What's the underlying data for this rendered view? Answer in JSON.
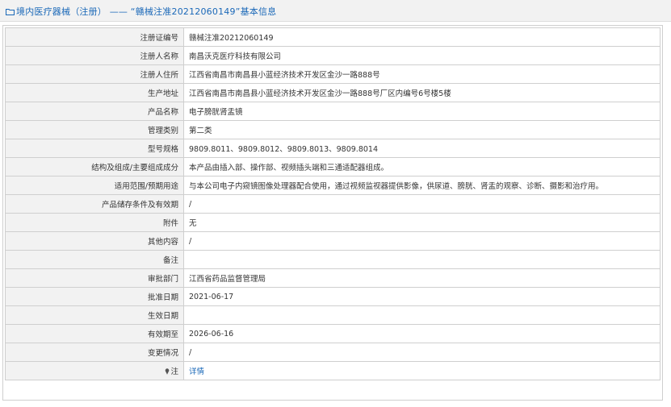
{
  "header": {
    "title": "境内医疗器械（注册） —— “赣械注准20212060149”基本信息"
  },
  "rows": [
    {
      "label": "注册证编号",
      "value": "赣械注准20212060149"
    },
    {
      "label": "注册人名称",
      "value": "南昌沃克医疗科技有限公司"
    },
    {
      "label": "注册人住所",
      "value": "江西省南昌市南昌县小蓝经济技术开发区金沙一路888号"
    },
    {
      "label": "生产地址",
      "value": "江西省南昌市南昌县小蓝经济技术开发区金沙一路888号厂区内编号6号楼5楼"
    },
    {
      "label": "产品名称",
      "value": "电子膀胱肾盂镜"
    },
    {
      "label": "管理类别",
      "value": "第二类"
    },
    {
      "label": "型号规格",
      "value": "9809.8011、9809.8012、9809.8013、9809.8014"
    },
    {
      "label": "结构及组成/主要组成成分",
      "value": "本产品由插入部、操作部、视频插头端和三通适配器组成。"
    },
    {
      "label": "适用范围/预期用途",
      "value": "与本公司电子内窥镜图像处理器配合使用，通过视频监视器提供影像，供尿道、膀胱、肾盂的观察、诊断、摄影和治疗用。"
    },
    {
      "label": "产品储存条件及有效期",
      "value": "/"
    },
    {
      "label": "附件",
      "value": "无"
    },
    {
      "label": "其他内容",
      "value": "/"
    },
    {
      "label": "备注",
      "value": ""
    },
    {
      "label": "审批部门",
      "value": "江西省药品监督管理局"
    },
    {
      "label": "批准日期",
      "value": "2021-06-17"
    },
    {
      "label": "生效日期",
      "value": ""
    },
    {
      "label": "有效期至",
      "value": "2026-06-16"
    },
    {
      "label": "变更情况",
      "value": "/"
    }
  ],
  "note_row": {
    "label": "注",
    "icon": "pin-icon",
    "link": "详情"
  }
}
